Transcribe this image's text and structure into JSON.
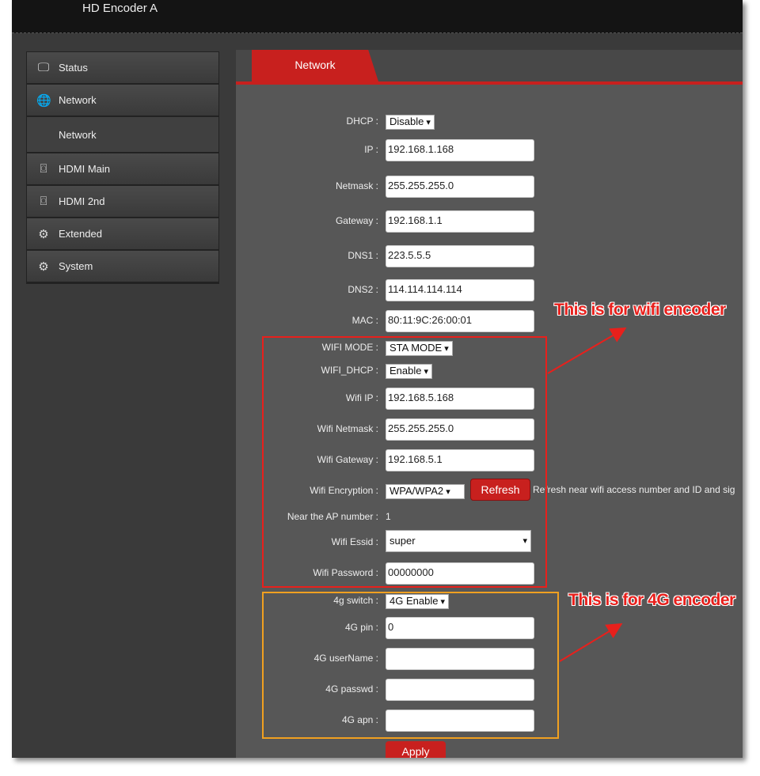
{
  "app": {
    "title": "HD Encoder  A"
  },
  "sidebar": {
    "items": [
      {
        "label": "Status",
        "icon": "monitor-icon",
        "glyph": "🖵"
      },
      {
        "label": "Network",
        "icon": "globe-icon",
        "glyph": "🌐"
      },
      {
        "label": "Network",
        "icon": "",
        "glyph": "",
        "sub": true
      },
      {
        "label": "HDMI Main",
        "icon": "hdmi-icon",
        "glyph": "⌼"
      },
      {
        "label": "HDMI 2nd",
        "icon": "hdmi-icon",
        "glyph": "⌼"
      },
      {
        "label": "Extended",
        "icon": "dotted-gear-icon",
        "glyph": "⚙"
      },
      {
        "label": "System",
        "icon": "gear-icon",
        "glyph": "⚙"
      }
    ]
  },
  "main": {
    "tab": "Network",
    "fields": [
      {
        "label": "DHCP :",
        "type": "select",
        "value": "Disable"
      },
      {
        "label": "IP :",
        "type": "input",
        "value": "192.168.1.168"
      },
      {
        "label": "Netmask :",
        "type": "input",
        "value": "255.255.255.0"
      },
      {
        "label": "Gateway :",
        "type": "input",
        "value": "192.168.1.1"
      },
      {
        "label": "DNS1 :",
        "type": "input",
        "value": "223.5.5.5"
      },
      {
        "label": "DNS2 :",
        "type": "input",
        "value": "114.114.114.114"
      },
      {
        "label": "MAC :",
        "type": "input",
        "value": "80:11:9C:26:00:01"
      },
      {
        "label": "WIFI MODE :",
        "type": "select",
        "value": "STA MODE"
      },
      {
        "label": "WIFI_DHCP :",
        "type": "select",
        "value": "Enable"
      },
      {
        "label": "Wifi IP :",
        "type": "input",
        "value": "192.168.5.168"
      },
      {
        "label": "Wifi Netmask :",
        "type": "input",
        "value": "255.255.255.0"
      },
      {
        "label": "Wifi Gateway :",
        "type": "input",
        "value": "192.168.5.1"
      },
      {
        "label": "Wifi Encryption :",
        "type": "select",
        "value": "WPA/WPA2"
      },
      {
        "label": "Near the AP number :",
        "type": "text",
        "value": "1"
      },
      {
        "label": "Wifi Essid :",
        "type": "wideselect",
        "value": "super"
      },
      {
        "label": "Wifi Password :",
        "type": "input",
        "value": "00000000"
      },
      {
        "label": "4g switch :",
        "type": "select",
        "value": "4G Enable"
      },
      {
        "label": "4G pin :",
        "type": "input",
        "value": "0"
      },
      {
        "label": "4G userName :",
        "type": "input",
        "value": ""
      },
      {
        "label": "4G passwd :",
        "type": "input",
        "value": ""
      },
      {
        "label": "4G apn :",
        "type": "input",
        "value": ""
      }
    ],
    "refresh_label": "Refresh",
    "refresh_hint": "Refresh near wifi access number and ID and sig",
    "apply_label": "Apply"
  },
  "annotations": {
    "wifi": "This is for wifi encoder",
    "g4": "This is for 4G encoder"
  },
  "colors": {
    "accent": "#c8201e",
    "wifi_box": "#e8201c",
    "g4_box": "#f0a020"
  }
}
